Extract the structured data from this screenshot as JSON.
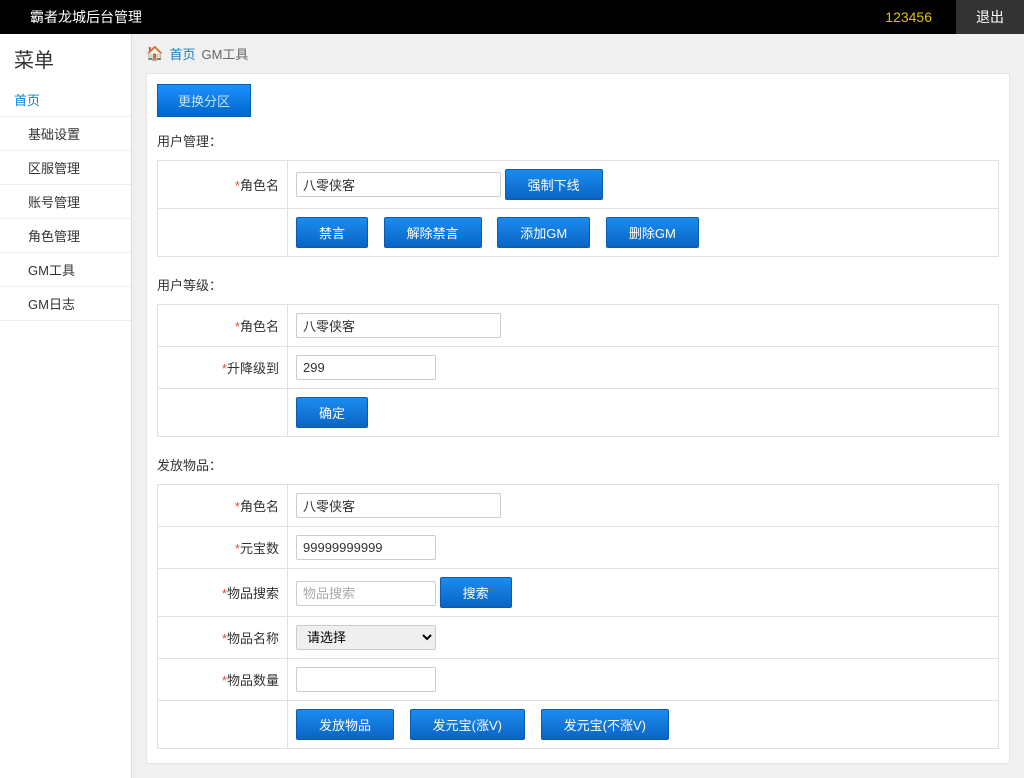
{
  "topbar": {
    "title": "霸者龙城后台管理",
    "user": "123456",
    "logout": "退出"
  },
  "sidebar": {
    "header": "菜单",
    "home": "首页",
    "items": [
      "基础设置",
      "区服管理",
      "账号管理",
      "角色管理",
      "GM工具",
      "GM日志"
    ]
  },
  "breadcrumb": {
    "home_label": "首页",
    "current": "GM工具"
  },
  "switch_zone_btn": "更换分区",
  "section1": {
    "title": "用户管理：",
    "role_label": "角色名",
    "role_value": "八零侠客",
    "force_offline": "强制下线",
    "mute": "禁言",
    "unmute": "解除禁言",
    "add_gm": "添加GM",
    "del_gm": "删除GM"
  },
  "section2": {
    "title": "用户等级：",
    "role_label": "角色名",
    "role_value": "八零侠客",
    "level_label": "升降级到",
    "level_value": "299",
    "confirm": "确定"
  },
  "section3": {
    "title": "发放物品：",
    "role_label": "角色名",
    "role_value": "八零侠客",
    "gold_label": "元宝数",
    "gold_value": "99999999999",
    "search_label": "物品搜索",
    "search_placeholder": "物品搜索",
    "search_btn": "搜索",
    "item_name_label": "物品名称",
    "item_name_placeholder": "请选择",
    "qty_label": "物品数量",
    "qty_value": "",
    "give_item": "发放物品",
    "give_gold_v": "发元宝(涨V)",
    "give_gold_nv": "发元宝(不涨V)"
  }
}
